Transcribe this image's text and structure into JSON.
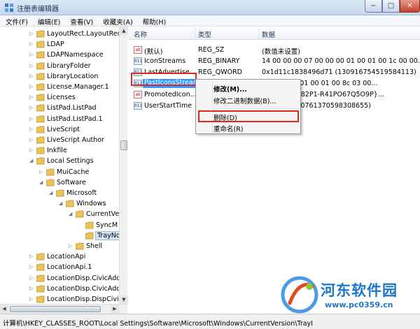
{
  "window": {
    "title": "注册表编辑器",
    "controls": {
      "minimize": "−",
      "maximize": "□",
      "close": "✕"
    }
  },
  "menu": [
    "文件(F)",
    "编辑(E)",
    "查看(V)",
    "收藏夹(A)",
    "帮助(H)"
  ],
  "tree": {
    "items": [
      {
        "label": "LayoutRect.LayoutRect.",
        "expander": "▷"
      },
      {
        "label": "LDAP",
        "expander": "▷"
      },
      {
        "label": "LDAPNamespace",
        "expander": "▷"
      },
      {
        "label": "LibraryFolder",
        "expander": "▷"
      },
      {
        "label": "LibraryLocation",
        "expander": "▷"
      },
      {
        "label": "License.Manager.1",
        "expander": "▷"
      },
      {
        "label": "Licenses",
        "expander": "▷"
      },
      {
        "label": "ListPad.ListPad",
        "expander": "▷"
      },
      {
        "label": "ListPad.ListPad.1",
        "expander": "▷"
      },
      {
        "label": "LiveScript",
        "expander": "▷"
      },
      {
        "label": "LiveScript Author",
        "expander": "▷"
      },
      {
        "label": "Inkfile",
        "expander": "▷"
      },
      {
        "label": "Local Settings",
        "expander": "◢"
      },
      {
        "label": "MuiCache",
        "expander": "▷"
      },
      {
        "label": "Software",
        "expander": "◢"
      },
      {
        "label": "Microsoft",
        "expander": "◢"
      },
      {
        "label": "Windows",
        "expander": "◢"
      },
      {
        "label": "CurrentVe",
        "expander": "◢"
      },
      {
        "label": "SyncM",
        "expander": ""
      },
      {
        "label": "TrayNo",
        "expander": ""
      },
      {
        "label": "Shell",
        "expander": "▷"
      },
      {
        "label": "LocationApi",
        "expander": "▷"
      },
      {
        "label": "LocationApi.1",
        "expander": "▷"
      },
      {
        "label": "LocationDisp.CivicAddr",
        "expander": "▷"
      },
      {
        "label": "LocationDisp.CivicAddr",
        "expander": "▷"
      },
      {
        "label": "LocationDisp.DispCivic",
        "expander": "▷"
      }
    ]
  },
  "list": {
    "headers": {
      "name": "名称",
      "type": "类型",
      "data": "数据"
    },
    "rows": [
      {
        "icon": "ab",
        "name": "(默认)",
        "type": "REG_SZ",
        "data": "(数值未设置)"
      },
      {
        "icon": "011",
        "name": "IconStreams",
        "type": "REG_BINARY",
        "data": "14 00 00 00 07 00 00 00 01 00 01 00 1c 00 00..."
      },
      {
        "icon": "011",
        "name": "LastAdvertise...",
        "type": "REG_QWORD",
        "data": "0x1d11c1838496d71 (130916754519584113)"
      },
      {
        "icon": "011",
        "name": "PastIconsStream",
        "type": "",
        "data": "0 00 00 00 01 00 01 00 8c 03 00..."
      },
      {
        "icon": "ab",
        "name": "PromotedIcon...",
        "type": "",
        "data": "23R3-4229-82P1-R41PO67Q5O9P}..."
      },
      {
        "icon": "011",
        "name": "UserStartTime",
        "type": "",
        "data": "4dafb2f (130761370598308655)"
      }
    ]
  },
  "context_menu": {
    "items": [
      "修改(M)...",
      "修改二进制数据(B)...",
      "删除(D)",
      "重命名(R)"
    ]
  },
  "status": "计算机\\HKEY_CLASSES_ROOT\\Local Settings\\Software\\Microsoft\\Windows\\CurrentVersion\\TrayI",
  "watermark": {
    "title": "河东软件园",
    "url": "www.pc0359.cn"
  }
}
